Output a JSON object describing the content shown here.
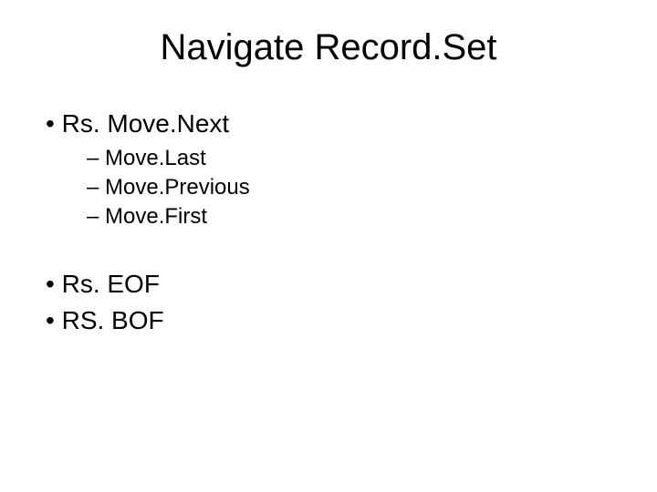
{
  "title": "Navigate Record.Set",
  "items": {
    "level1_a": "Rs. Move.Next",
    "level2": [
      "Move.Last",
      "Move.Previous",
      "Move.First"
    ],
    "level1_b": "Rs. EOF",
    "level1_c": "RS. BOF"
  }
}
